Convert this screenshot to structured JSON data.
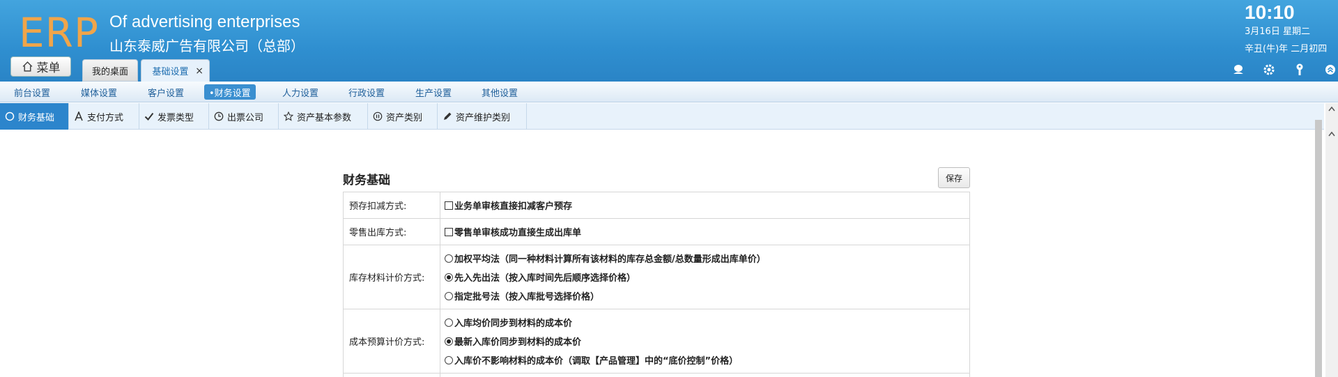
{
  "header": {
    "logo": "ERP",
    "company_en": "Of advertising enterprises",
    "company_cn": "山东泰威广告有限公司（总部）",
    "time": "10:10",
    "date_line1": "3月16日 星期二",
    "date_line2": "辛丑(牛)年 二月初四",
    "menu_label": "菜单",
    "tabs": [
      {
        "label": "我的桌面"
      },
      {
        "label": "基础设置",
        "close": "×"
      }
    ],
    "icons": [
      "user-icon",
      "gear-icon",
      "key-icon",
      "collapse-icon"
    ]
  },
  "nav": {
    "items": [
      {
        "label": "前台设置"
      },
      {
        "label": "媒体设置"
      },
      {
        "label": "客户设置"
      },
      {
        "label": "•财务设置",
        "active": true
      },
      {
        "label": "人力设置"
      },
      {
        "label": "行政设置"
      },
      {
        "label": "生产设置"
      },
      {
        "label": "其他设置"
      }
    ]
  },
  "subnav": {
    "items": [
      {
        "label": "财务基础",
        "icon": "circle-icon",
        "active": true
      },
      {
        "label": "支付方式",
        "icon": "letter-a-icon"
      },
      {
        "label": "发票类型",
        "icon": "check-icon"
      },
      {
        "label": "出票公司",
        "icon": "clock-icon"
      },
      {
        "label": "资产基本参数",
        "icon": "star-icon"
      },
      {
        "label": "资产类别",
        "icon": "pause-icon"
      },
      {
        "label": "资产维护类别",
        "icon": "pencil-icon"
      }
    ]
  },
  "content": {
    "title": "财务基础",
    "save_label": "保存",
    "rows": [
      {
        "label": "预存扣减方式:",
        "options": [
          {
            "type": "checkbox",
            "checked": false,
            "text": "业务单审核直接扣减客户预存"
          }
        ]
      },
      {
        "label": "零售出库方式:",
        "options": [
          {
            "type": "checkbox",
            "checked": false,
            "text": "零售单审核成功直接生成出库单"
          }
        ]
      },
      {
        "label": "库存材料计价方式:",
        "options": [
          {
            "type": "radio",
            "checked": false,
            "text": "加权平均法（同一种材料计算所有该材料的库存总金额/总数量形成出库单价）"
          },
          {
            "type": "radio",
            "checked": true,
            "text": "先入先出法（按入库时间先后顺序选择价格）"
          },
          {
            "type": "radio",
            "checked": false,
            "text": "指定批号法（按入库批号选择价格）"
          }
        ]
      },
      {
        "label": "成本预算计价方式:",
        "options": [
          {
            "type": "radio",
            "checked": false,
            "text": "入库均价同步到材料的成本价"
          },
          {
            "type": "radio",
            "checked": true,
            "text": "最新入库价同步到材料的成本价"
          },
          {
            "type": "radio",
            "checked": false,
            "text": "入库价不影响材料的成本价（调取【产品管理】中的“底价控制”价格）"
          }
        ]
      }
    ]
  }
}
